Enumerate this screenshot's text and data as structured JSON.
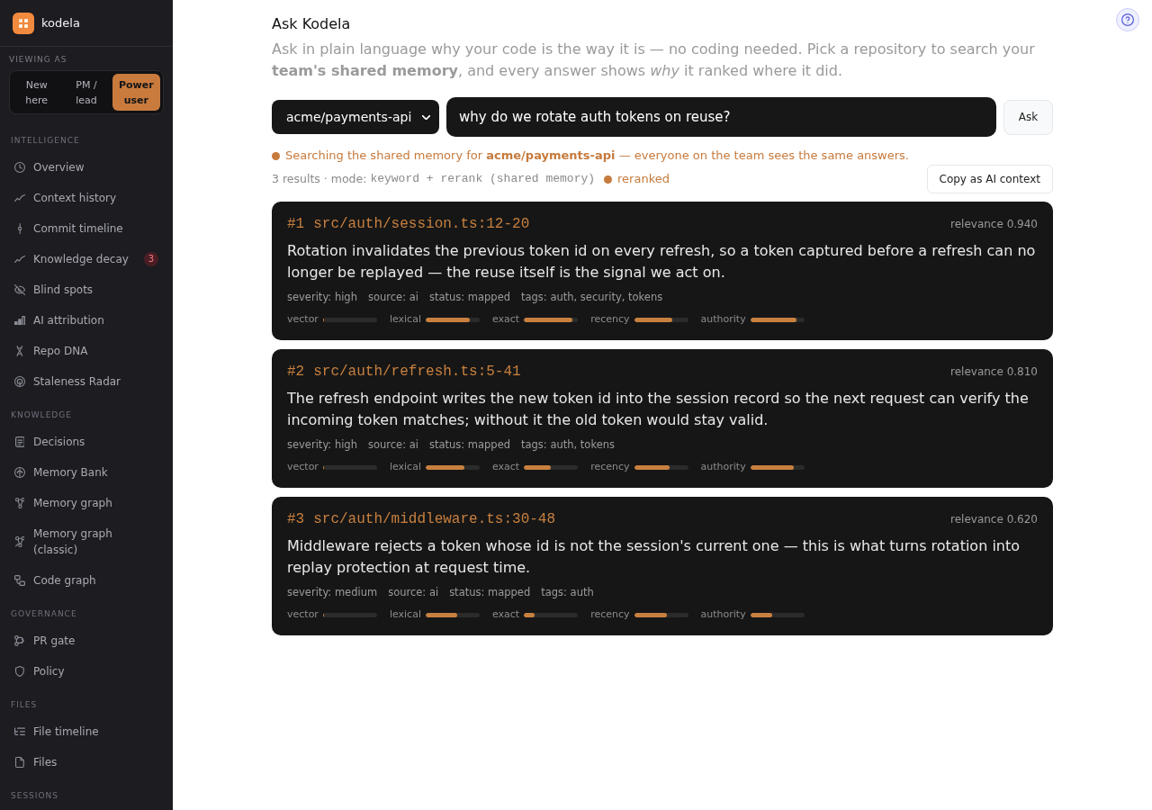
{
  "sidebar": {
    "brand": "kodela",
    "viewing_as": {
      "label": "VIEWING AS",
      "options": [
        {
          "label": "New here",
          "selected": false
        },
        {
          "label": "PM / lead",
          "selected": false
        },
        {
          "label": "Power user",
          "selected": true
        }
      ]
    },
    "sections": [
      {
        "label": "INTELLIGENCE",
        "items": [
          {
            "label": "Overview",
            "selected": false
          },
          {
            "label": "Context history",
            "selected": false
          },
          {
            "label": "Commit timeline",
            "selected": false
          },
          {
            "label": "Knowledge decay",
            "selected": false,
            "badge": "3"
          },
          {
            "label": "Blind spots",
            "selected": false
          },
          {
            "label": "AI attribution",
            "selected": false
          },
          {
            "label": "Repo DNA",
            "selected": false
          },
          {
            "label": "Staleness Radar",
            "selected": false
          }
        ]
      },
      {
        "label": "KNOWLEDGE",
        "items": [
          {
            "label": "Decisions",
            "selected": false
          },
          {
            "label": "Memory Bank",
            "selected": false
          },
          {
            "label": "Memory graph",
            "selected": false
          },
          {
            "label": "Memory graph (classic)",
            "selected": false
          },
          {
            "label": "Code graph",
            "selected": false
          }
        ]
      },
      {
        "label": "GOVERNANCE",
        "items": [
          {
            "label": "PR gate",
            "selected": false
          },
          {
            "label": "Policy",
            "selected": false
          }
        ]
      },
      {
        "label": "FILES",
        "items": [
          {
            "label": "File timeline",
            "selected": false
          },
          {
            "label": "Files",
            "selected": false
          }
        ]
      },
      {
        "label": "SESSIONS"
      }
    ]
  },
  "main": {
    "title": "Ask Kodela",
    "description": "Ask in plain language why your code is the way it is — no coding needed. Pick a repository to search your **team's shared memory**, and every answer shows *why* it ranked where it did.",
    "repository": "acme/payments-api",
    "query": "why do we rotate auth tokens on reuse?",
    "ask_button": "Ask",
    "scope_notice": "Searching the shared memory for **acme/payments-api** — everyone on the team sees the same answers.",
    "summary": {
      "count": "3 results · mode:",
      "mode": "keyword + rerank (shared memory)",
      "status": "reranked"
    },
    "copy_button": "Copy as AI context",
    "results": [
      {
        "rank": "#1",
        "location": "src/auth/session.ts:12-20",
        "relevance": "relevance 0.940",
        "text": "Rotation invalidates the previous token id on every refresh, so a token captured before a refresh can no longer be replayed — the reuse itself is the signal we act on.",
        "meta": [
          "severity: high",
          "source: ai",
          "status: mapped",
          "tags: auth, security, tokens"
        ],
        "signals": [
          {
            "label": "vector",
            "level": 0
          },
          {
            "label": "lexical",
            "level": 0.82
          },
          {
            "label": "exact",
            "level": 0.9
          },
          {
            "label": "recency",
            "level": 0.7
          },
          {
            "label": "authority",
            "level": 0.85
          }
        ]
      },
      {
        "rank": "#2",
        "location": "src/auth/refresh.ts:5-41",
        "relevance": "relevance 0.810",
        "text": "The refresh endpoint writes the new token id into the session record so the next request can verify the incoming token matches; without it the old token would stay valid.",
        "meta": [
          "severity: high",
          "source: ai",
          "status: mapped",
          "tags: auth, tokens"
        ],
        "signals": [
          {
            "label": "vector",
            "level": 0
          },
          {
            "label": "lexical",
            "level": 0.72
          },
          {
            "label": "exact",
            "level": 0.5
          },
          {
            "label": "recency",
            "level": 0.65
          },
          {
            "label": "authority",
            "level": 0.81
          }
        ]
      },
      {
        "rank": "#3",
        "location": "src/auth/middleware.ts:30-48",
        "relevance": "relevance 0.620",
        "text": "Middleware rejects a token whose id is not the session's current one — this is what turns rotation into replay protection at request time.",
        "meta": [
          "severity: medium",
          "source: ai",
          "status: mapped",
          "tags: auth"
        ],
        "signals": [
          {
            "label": "vector",
            "level": 0
          },
          {
            "label": "lexical",
            "level": 0.58
          },
          {
            "label": "exact",
            "level": 0.2
          },
          {
            "label": "recency",
            "level": 0.6
          },
          {
            "label": "authority",
            "level": 0.4
          }
        ]
      }
    ]
  }
}
